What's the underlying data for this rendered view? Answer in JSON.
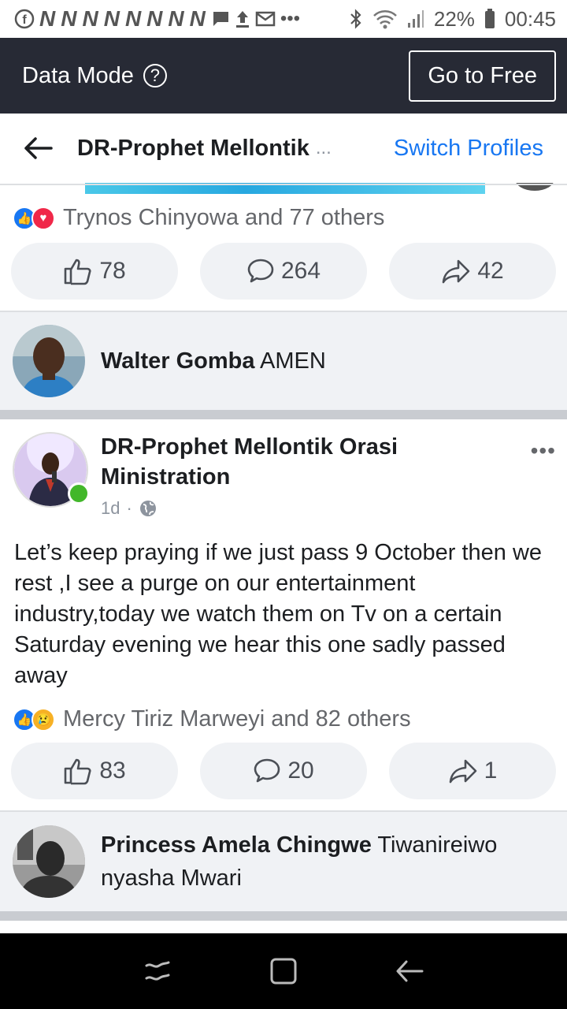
{
  "status_bar": {
    "carrier_icon": "facebook-icon",
    "notification_letters": [
      "N",
      "N",
      "N",
      "N",
      "N",
      "N",
      "N",
      "N"
    ],
    "battery": "22%",
    "time": "00:45"
  },
  "data_bar": {
    "label": "Data Mode",
    "help_icon": "?",
    "button": "Go to Free"
  },
  "header": {
    "title": "DR-Prophet Mellontik",
    "ellipsis": "...",
    "switch": "Switch Profiles"
  },
  "post1": {
    "reactions_text": "Trynos Chinyowa and 77 others",
    "likes": "78",
    "comments": "264",
    "shares": "42",
    "top_comment": {
      "author": "Walter Gomba",
      "text": "AMEN"
    }
  },
  "post2": {
    "author": "DR-Prophet Mellontik Orasi Ministration",
    "time": "1d",
    "dot": "·",
    "text": "Let’s keep praying if we just pass 9 October then we rest ,I see a purge on our entertainment industry,today we watch them on Tv on a certain Saturday evening we hear this one sadly passed away",
    "reactions_text": "Mercy Tiriz Marweyi and 82 others",
    "likes": "83",
    "comments": "20",
    "shares": "1",
    "top_comment": {
      "author": "Princess Amela Chingwe",
      "text": "Tiwanireiwo nyasha Mwari"
    }
  },
  "colors": {
    "accent": "#1877f2",
    "dark_bar": "#272a35"
  }
}
